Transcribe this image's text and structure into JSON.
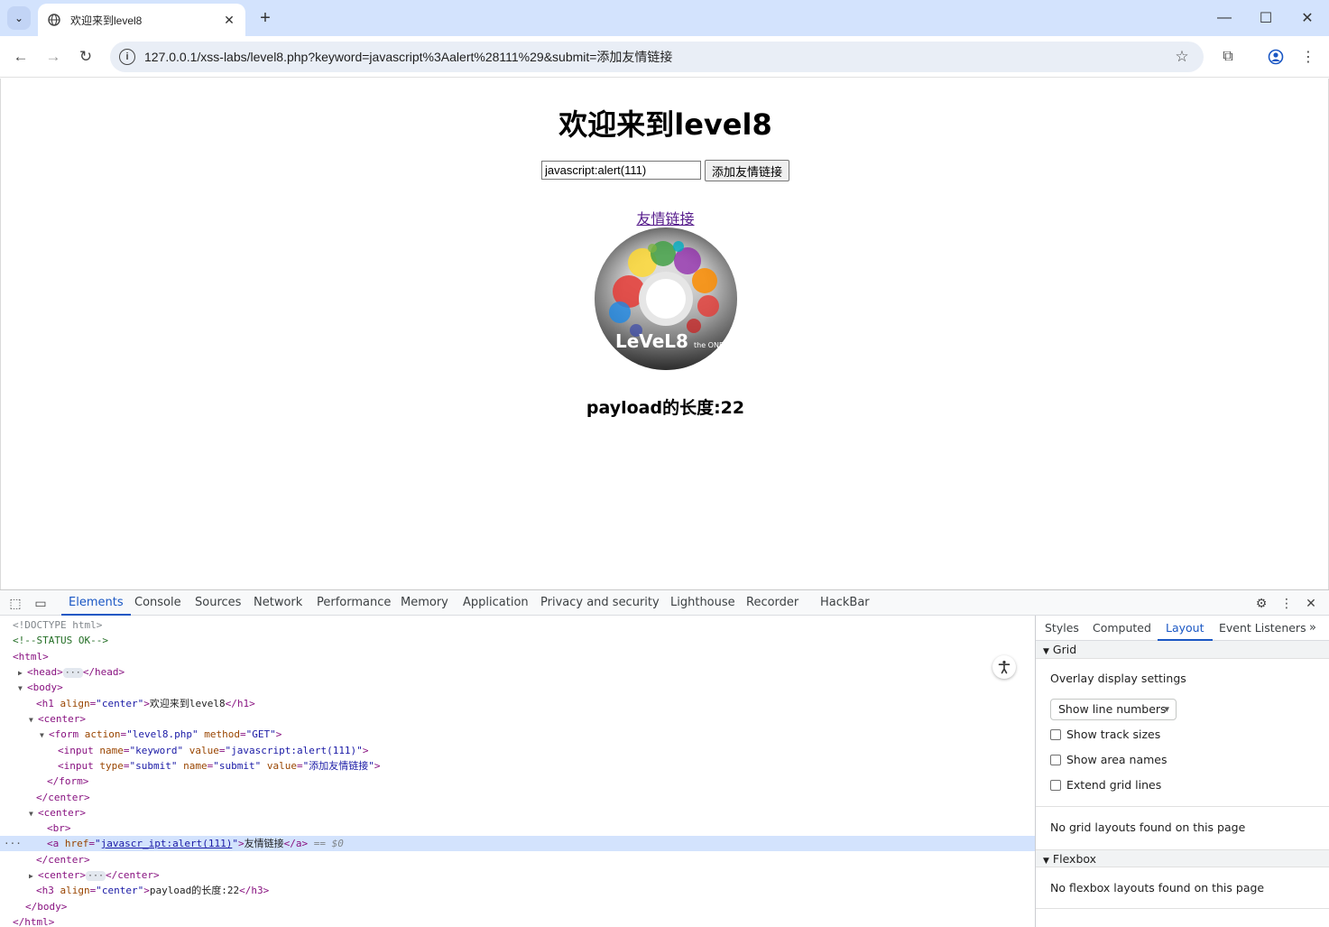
{
  "browser": {
    "tab_title": "欢迎来到level8",
    "url": "127.0.0.1/xss-labs/level8.php?keyword=javascript%3Aalert%28111%29&submit=添加友情链接"
  },
  "page": {
    "heading": "欢迎来到level8",
    "input_value": "javascript:alert(111)",
    "submit_label": "添加友情链接",
    "link_text": "友情链接",
    "disc_text": "LeVeL8",
    "disc_tag": "the ONE",
    "payload_text": "payload的长度:22"
  },
  "devtools": {
    "tabs": [
      "Elements",
      "Console",
      "Sources",
      "Network",
      "Performance",
      "Memory",
      "Application",
      "Privacy and security",
      "Lighthouse",
      "Recorder",
      "HackBar"
    ],
    "active_tab": "Elements",
    "dom": {
      "doctype": "<!DOCTYPE html>",
      "comment": "<!--STATUS OK-->",
      "html_open": "<html>",
      "head": "<head>",
      "head_close": "</head>",
      "body_open": "<body>",
      "h1_tag": "<h1",
      "h1_attr": "align",
      "h1_val": "\"center\"",
      "h1_text": "欢迎来到level8",
      "h1_close": "</h1>",
      "center_open": "<center>",
      "form_tag": "<form",
      "form_attr1": "action",
      "form_val1": "\"level8.php\"",
      "form_attr2": "method",
      "form_val2": "\"GET\"",
      "input1_tag": "<input",
      "input1_attr1": "name",
      "input1_val1": "\"keyword\"",
      "input1_attr2": "value",
      "input1_val2": "\"javascript:alert(111)\"",
      "input2_tag": "<input",
      "input2_attr1": "type",
      "input2_val1": "\"submit\"",
      "input2_attr2": "name",
      "input2_val2": "\"submit\"",
      "input2_attr3": "value",
      "input2_val3": "\"添加友情链接\"",
      "form_close": "</form>",
      "center_close": "</center>",
      "br": "<br>",
      "a_tag": "<a",
      "a_attr": "href",
      "a_val": "javascr_ipt:alert(111)",
      "a_text": "友情链接",
      "a_close": "</a>",
      "a_marker": "== $0",
      "h3_tag": "<h3",
      "h3_attr": "align",
      "h3_val": "\"center\"",
      "h3_text": "payload的长度:22",
      "h3_close": "</h3>",
      "body_close": "</body>",
      "html_close": "</html>",
      "gt": ">",
      "eq": "=",
      "q": "\""
    },
    "sidebar": {
      "tabs": [
        "Styles",
        "Computed",
        "Layout",
        "Event Listeners"
      ],
      "active_tab": "Layout",
      "grid_title": "Grid",
      "overlay_settings": "Overlay display settings",
      "select_value": "Show line numbers",
      "check1": "Show track sizes",
      "check2": "Show area names",
      "check3": "Extend grid lines",
      "no_grid": "No grid layouts found on this page",
      "flexbox_title": "Flexbox",
      "no_flexbox": "No flexbox layouts found on this page"
    }
  },
  "colors": {
    "titlebar": "#d3e3fd",
    "accent": "#1a57c4",
    "link_visited": "#551a8b"
  },
  "icons": [
    "tab-search-icon",
    "globe-icon",
    "close-icon",
    "plus-icon",
    "minimize-icon",
    "maximize-icon",
    "back-icon",
    "forward-icon",
    "reload-icon",
    "info-icon",
    "star-icon",
    "extensions-icon",
    "profile-icon",
    "menu-icon",
    "inspect-icon",
    "device-icon",
    "gear-icon",
    "kebab-icon",
    "accessibility-icon"
  ]
}
